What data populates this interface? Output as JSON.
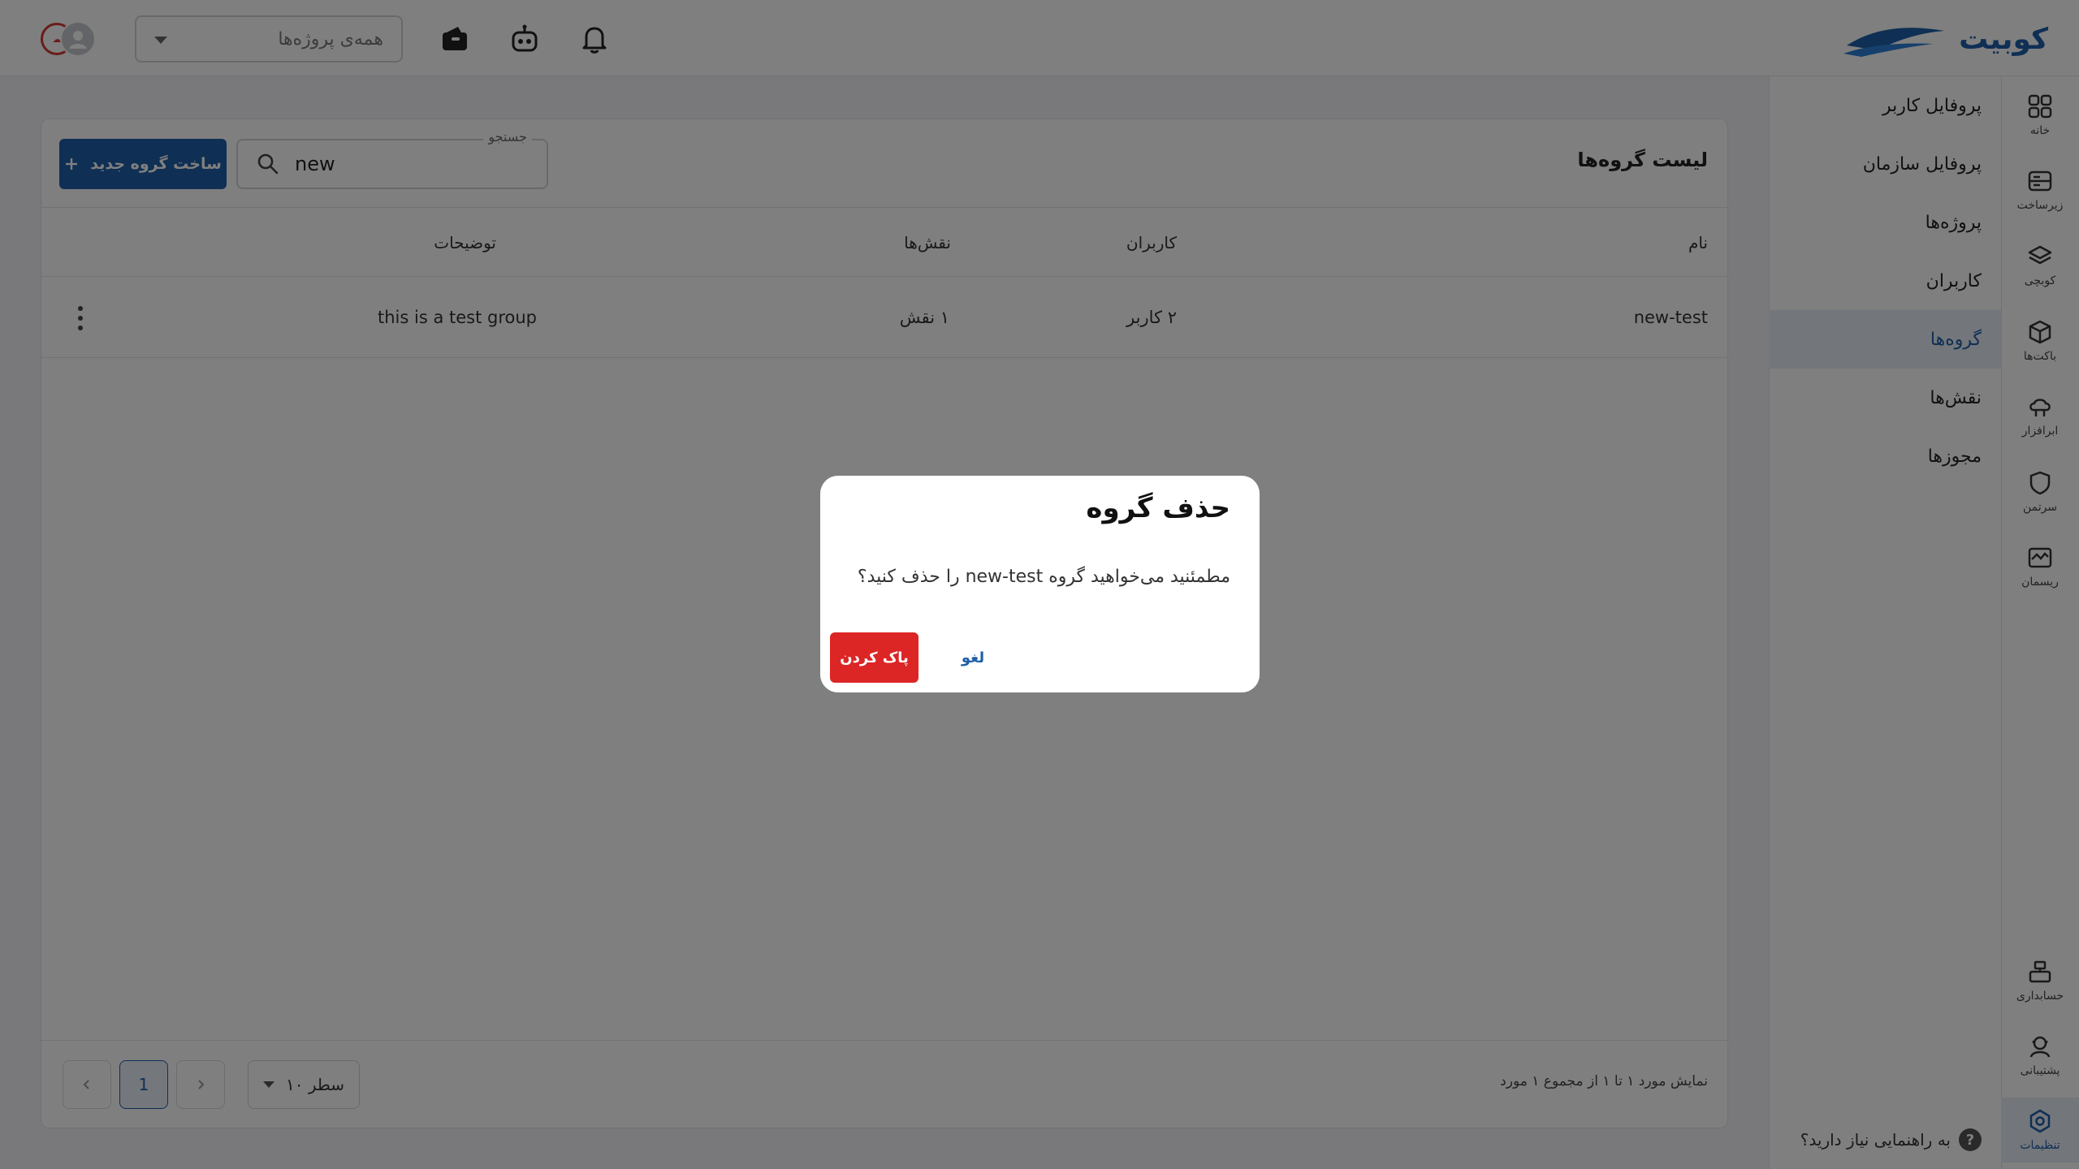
{
  "brand": {
    "name": "کوبیت",
    "color": "#1f5fa8"
  },
  "topbar": {
    "project_select_placeholder": "همه‌ی پروژه‌ها",
    "icons": [
      "notification-bell-icon",
      "robot-icon",
      "wallet-icon"
    ],
    "avatar_badge": "cloud"
  },
  "rail": {
    "items": [
      {
        "label": "خانه",
        "icon": "grid-icon"
      },
      {
        "label": "زیرساخت",
        "icon": "server-icon"
      },
      {
        "label": "کوبچی",
        "icon": "layers-icon"
      },
      {
        "label": "باکت‌ها",
        "icon": "cube-icon"
      },
      {
        "label": "ابرافزار",
        "icon": "cloud-app-icon"
      },
      {
        "label": "سرتمن",
        "icon": "shield-icon"
      },
      {
        "label": "ریسمان",
        "icon": "monitor-icon"
      },
      {
        "label": "حسابداری",
        "icon": "cash-register-icon"
      },
      {
        "label": "پشتیبانی",
        "icon": "support-icon"
      },
      {
        "label": "تنظیمات",
        "icon": "settings-icon"
      }
    ]
  },
  "subnav": {
    "items": [
      {
        "label": "پروفایل کاربر"
      },
      {
        "label": "پروفایل سازمان"
      },
      {
        "label": "پروژه‌ها"
      },
      {
        "label": "کاربران"
      },
      {
        "label": "گروه‌ها"
      },
      {
        "label": "نقش‌ها"
      },
      {
        "label": "مجوزها"
      }
    ],
    "help": "به راهنمایی نیاز دارید؟"
  },
  "main": {
    "title": "لیست گروه‌ها",
    "create_button": "ساخت گروه جدید",
    "search": {
      "legend": "جستجو",
      "value": "new"
    },
    "columns": {
      "name": "نام",
      "users": "کاربران",
      "roles": "نقش‌ها",
      "description": "توضیحات"
    },
    "rows": [
      {
        "name": "new-test",
        "users": "۲ کاربر",
        "roles": "۱ نقش",
        "description": "this is a test group"
      }
    ],
    "footer_info": "نمایش مورد ۱ تا ۱ از مجموع ۱ مورد",
    "pagination": {
      "current": "1",
      "rows_per_page": "۱۰ سطر"
    }
  },
  "modal": {
    "title": "حذف گروه",
    "body": "مطمئنید می‌خواهید گروه new-test را حذف کنید؟",
    "delete_button": "پاک کردن",
    "cancel_button": "لغو",
    "delete_color": "#dc2626"
  }
}
